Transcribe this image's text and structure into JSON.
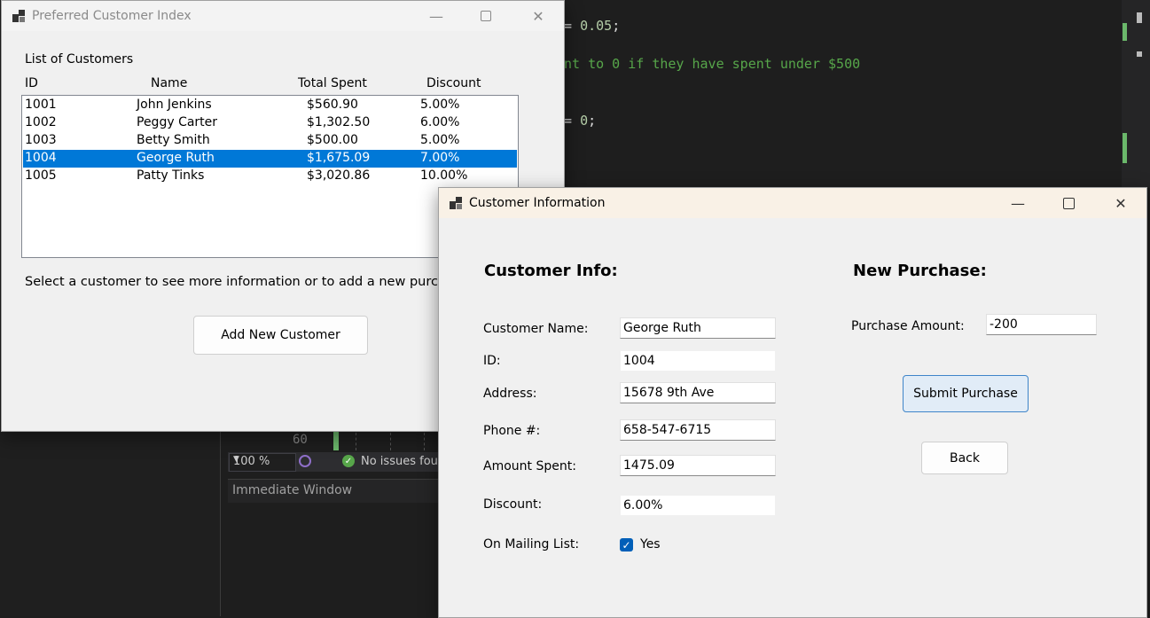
{
  "background_ide": {
    "code_line_1_prefix": "= ",
    "code_line_1_value": "0.05",
    "code_line_1_suffix": ";",
    "code_comment": "nt to 0 if they have spent under $500",
    "code_line_3_prefix": "= ",
    "code_line_3_value": "0",
    "code_line_3_suffix": ";",
    "line_number": "60",
    "zoom": "100 %",
    "issues_text": "No issues four",
    "immediate_title": "Immediate Window"
  },
  "index_window": {
    "title": "Preferred Customer Index",
    "list_caption": "List of Customers",
    "columns": [
      "ID",
      "Name",
      "Total Spent",
      "Discount"
    ],
    "rows": [
      {
        "id": "1001",
        "name": "John Jenkins",
        "total": "$560.90",
        "discount": "5.00%"
      },
      {
        "id": "1002",
        "name": "Peggy Carter",
        "total": "$1,302.50",
        "discount": "6.00%"
      },
      {
        "id": "1003",
        "name": "Betty Smith",
        "total": "$500.00",
        "discount": "5.00%"
      },
      {
        "id": "1004",
        "name": "George Ruth",
        "total": "$1,675.09",
        "discount": "7.00%"
      },
      {
        "id": "1005",
        "name": "Patty Tinks",
        "total": "$3,020.86",
        "discount": "10.00%"
      }
    ],
    "selected_index": 3,
    "hint": "Select a customer to see more information or to add a new purchase.",
    "add_button": "Add New Customer"
  },
  "info_window": {
    "title": "Customer Information",
    "customer_info_heading": "Customer Info:",
    "new_purchase_heading": "New Purchase:",
    "labels": {
      "name": "Customer Name:",
      "id": "ID:",
      "address": "Address:",
      "phone": "Phone #:",
      "amount": "Amount Spent:",
      "discount": "Discount:",
      "mailing": "On Mailing List:",
      "purchase_amount": "Purchase Amount:"
    },
    "values": {
      "name": "George Ruth",
      "id": "1004",
      "address": "15678 9th Ave",
      "phone": "658-547-6715",
      "amount": "1475.09",
      "discount": "6.00%",
      "mailing_checked": true,
      "mailing_text": "Yes",
      "purchase_amount": "-200"
    },
    "submit_button": "Submit Purchase",
    "back_button": "Back"
  },
  "colors": {
    "selection": "#0078d7",
    "checkbox": "#005fb8",
    "code_number": "#b5cea8",
    "code_comment": "#57a64a"
  },
  "icons": [
    "app-icon",
    "minimize-icon",
    "maximize-icon",
    "close-icon",
    "check-icon",
    "status-ok-icon",
    "chevron-down-icon"
  ]
}
